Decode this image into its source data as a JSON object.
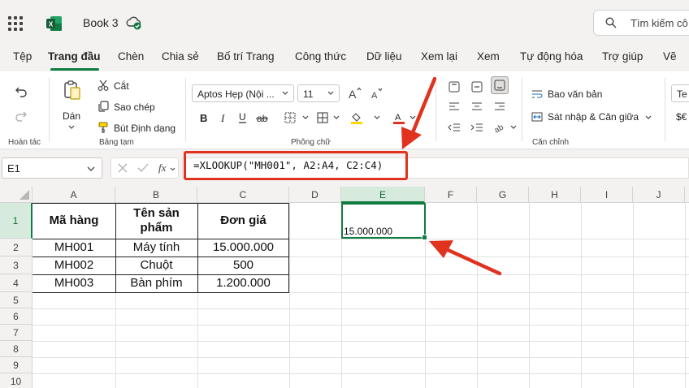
{
  "app": {
    "title": "Book 3",
    "search_placeholder": "Tìm kiếm cô"
  },
  "tabs": [
    {
      "label": "Tệp",
      "active": false
    },
    {
      "label": "Trang đầu",
      "active": true
    },
    {
      "label": "Chèn",
      "active": false
    },
    {
      "label": "Chia sẻ",
      "active": false
    },
    {
      "label": "Bố trí Trang",
      "active": false
    },
    {
      "label": "Công thức",
      "active": false
    },
    {
      "label": "Dữ liệu",
      "active": false
    },
    {
      "label": "Xem lại",
      "active": false
    },
    {
      "label": "Xem",
      "active": false
    },
    {
      "label": "Tự động hóa",
      "active": false
    },
    {
      "label": "Trợ giúp",
      "active": false
    },
    {
      "label": "Vẽ",
      "active": false
    }
  ],
  "ribbon": {
    "undo_group_label": "Hoàn tác",
    "clipboard": {
      "paste_label": "Dán",
      "cut_label": "Cắt",
      "copy_label": "Sao chép",
      "format_painter_label": "Bút Định dạng",
      "group_label": "Bảng tạm"
    },
    "font": {
      "font_name": "Aptos Hẹp (Nội ...",
      "font_size": "11",
      "group_label": "Phông chữ",
      "font_color": "#e0321e",
      "fill_color": "#ffd700"
    },
    "alignment": {
      "wrap_text_label": "Bao văn bản",
      "merge_label": "Sát nhập & Căn giữa",
      "group_label": "Căn chỉnh"
    },
    "number": {
      "format_partial": "Te",
      "currency_partial": "$€"
    }
  },
  "formula_bar": {
    "name_box": "E1",
    "fx_label": "fx",
    "formula": "=XLOOKUP(\"MH001\", A2:A4, C2:C4)"
  },
  "sheet": {
    "columns": [
      "A",
      "B",
      "C",
      "D",
      "E",
      "F",
      "G",
      "H",
      "I",
      "J"
    ],
    "rows": [
      "1",
      "2",
      "3",
      "4",
      "5",
      "6",
      "7",
      "8",
      "9",
      "10"
    ],
    "selected_cell": "E1",
    "selected_value": "15.000.000",
    "table": {
      "headers": [
        "Mã hàng",
        "Tên sản phẩm",
        "Đơn giá"
      ],
      "rows": [
        [
          "MH001",
          "Máy tính",
          "15.000.000"
        ],
        [
          "MH002",
          "Chuột",
          "500"
        ],
        [
          "MH003",
          "Bàn phím",
          "1.200.000"
        ]
      ]
    }
  },
  "annotation_color": "#e0321e",
  "accent_color": "#107c41"
}
